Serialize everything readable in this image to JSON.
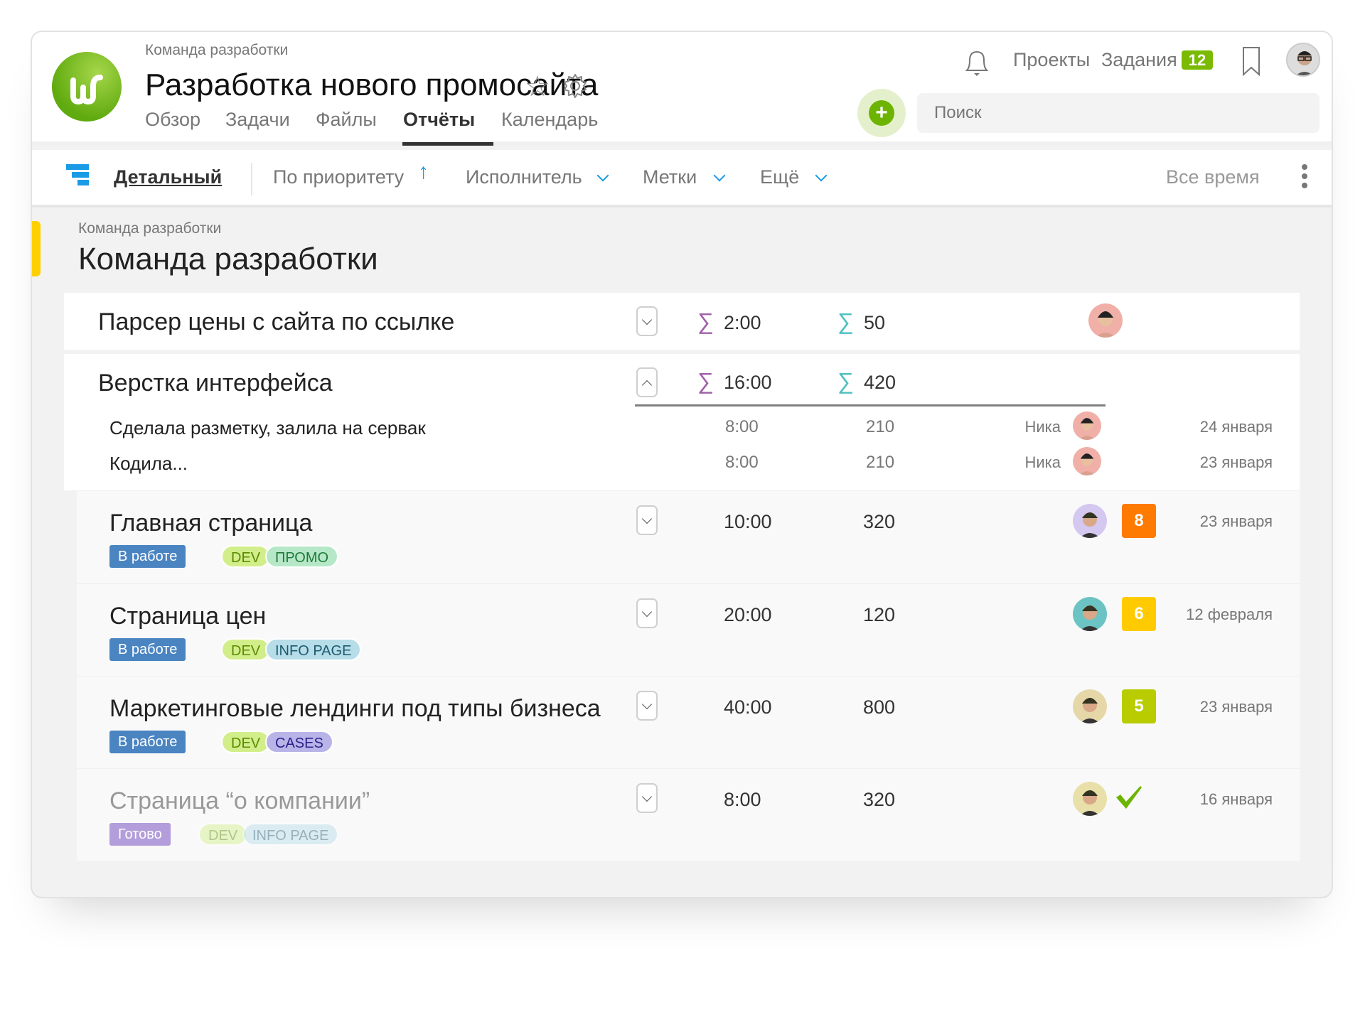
{
  "header": {
    "breadcrumb": "Команда разработки",
    "title": "Разработка нового промосайта",
    "tabs": [
      {
        "label": "Обзор"
      },
      {
        "label": "Задачи"
      },
      {
        "label": "Файлы"
      },
      {
        "label": "Отчёты",
        "active": true
      },
      {
        "label": "Календарь"
      }
    ],
    "nav": {
      "projects": "Проекты",
      "tasks": "Задания",
      "tasks_badge": "12"
    },
    "search_placeholder": "Поиск",
    "accent": "#7aba00"
  },
  "toolbar": {
    "view": "Детальный",
    "sort": "По приоритету",
    "assignee": "Исполнитель",
    "tags": "Метки",
    "more": "Ещё",
    "period": "Все время"
  },
  "section": {
    "breadcrumb": "Команда разработки",
    "title": "Команда разработки"
  },
  "groups": [
    {
      "title": "Парсер цены с сайта по ссылке",
      "time": "2:00",
      "value": "50",
      "expanded": false
    },
    {
      "title": "Верстка интерфейса",
      "time": "16:00",
      "value": "420",
      "expanded": true,
      "entries": [
        {
          "text": "Сделала разметку, залила на сервак",
          "time": "8:00",
          "value": "210",
          "user": "Ника",
          "date": "24 января"
        },
        {
          "text": "Кодила...",
          "time": "8:00",
          "value": "210",
          "user": "Ника",
          "date": "23 января"
        }
      ]
    }
  ],
  "tasks": [
    {
      "title": "Главная страница",
      "status": "В работе",
      "tags": [
        "DEV",
        "ПРОМО"
      ],
      "time": "10:00",
      "value": "320",
      "priority": "8",
      "priority_color": "#ff7a00",
      "date": "23 января",
      "avatar_color": "#d4c8f0"
    },
    {
      "title": "Страница цен",
      "status": "В работе",
      "tags": [
        "DEV",
        "INFO PAGE"
      ],
      "time": "20:00",
      "value": "120",
      "priority": "6",
      "priority_color": "#ffcb00",
      "date": "12 февраля",
      "avatar_color": "#6cc3c3"
    },
    {
      "title": "Маркетинговые лендинги под типы бизнеса",
      "status": "В работе",
      "tags": [
        "DEV",
        "CASES"
      ],
      "time": "40:00",
      "value": "800",
      "priority": "5",
      "priority_color": "#b8cc00",
      "date": "23 января",
      "avatar_color": "#e6d7a8"
    },
    {
      "title": "Страница “о компании”",
      "status": "Готово",
      "tags": [
        "DEV",
        "INFO PAGE"
      ],
      "time": "8:00",
      "value": "320",
      "priority": "done",
      "date": "16 января",
      "done": true,
      "avatar_color": "#e8e0a8"
    }
  ]
}
